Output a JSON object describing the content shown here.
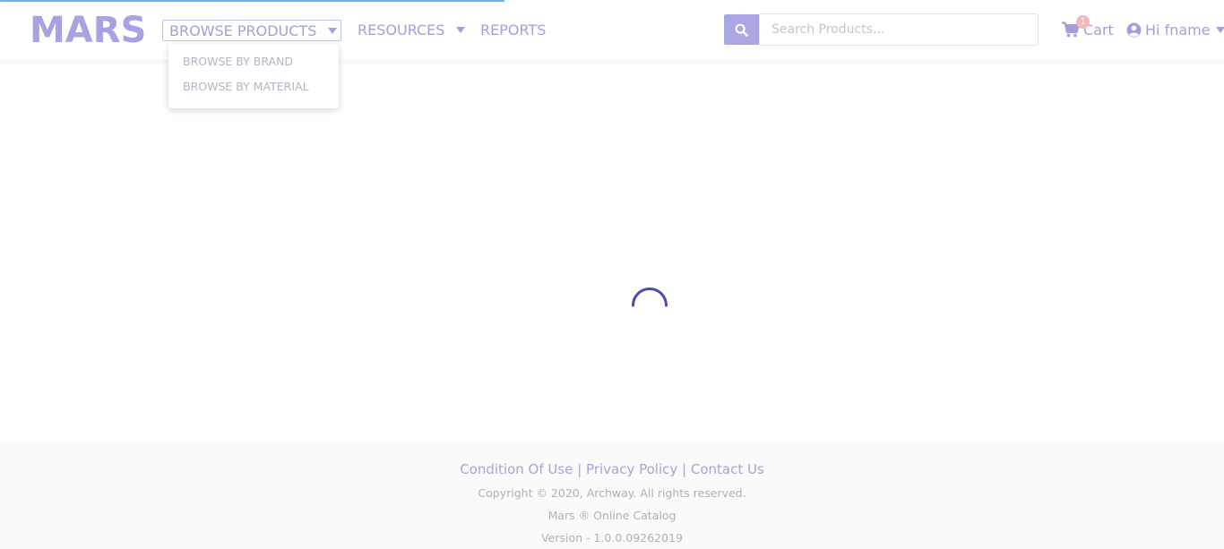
{
  "header": {
    "logo": "MARS",
    "nav": {
      "browse_products": "BROWSE PRODUCTS",
      "resources": "RESOURCES",
      "reports": "REPORTS"
    },
    "browse_menu": {
      "items": [
        "BROWSE BY BRAND",
        "BROWSE BY MATERIAL"
      ]
    },
    "search": {
      "placeholder": "Search Products...",
      "value": ""
    },
    "cart": {
      "label": "Cart",
      "count": "1"
    },
    "user": {
      "greeting": "Hi fname"
    }
  },
  "main": {
    "loading": true
  },
  "footer": {
    "links": {
      "condition": "Condition Of Use",
      "privacy": "Privacy Policy",
      "contact": "Contact Us"
    },
    "copyright": "Copyright © 2020, Archway. All rights reserved.",
    "catalog": "Mars ® Online Catalog",
    "version": "Version - 1.0.0.09262019"
  },
  "colors": {
    "accent": "#a7a3e0",
    "spinner": "#4a4bb0",
    "badge": "#f7b7b7",
    "progress": "#6ab4ef"
  },
  "icons": [
    "search-icon",
    "cart-icon",
    "user-circle-icon",
    "chevron-down-icon",
    "loading-spinner"
  ]
}
